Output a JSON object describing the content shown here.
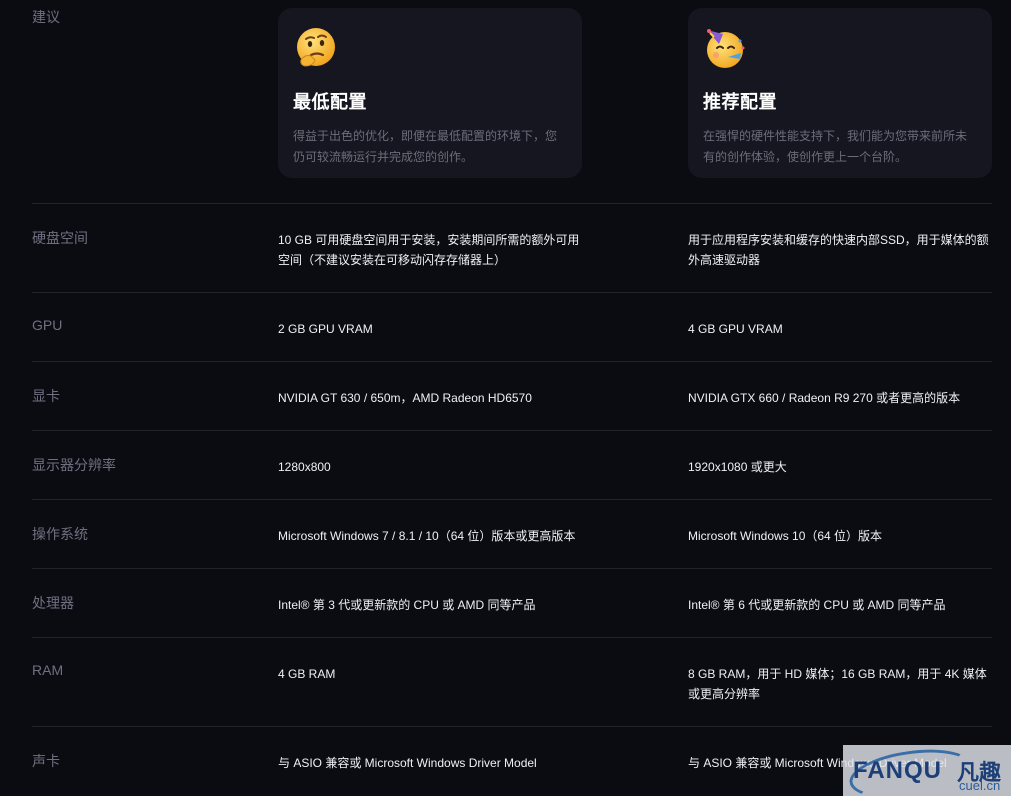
{
  "intro_label": "建议",
  "cards": {
    "min": {
      "icon": "thinking-face-emoji",
      "title": "最低配置",
      "description": "得益于出色的优化，即便在最低配置的环境下，您仍可较流畅运行并完成您的创作。"
    },
    "rec": {
      "icon": "partying-face-emoji",
      "title": "推荐配置",
      "description": "在强悍的硬件性能支持下，我们能为您带来前所未有的创作体验，使创作更上一个台阶。"
    }
  },
  "rows": [
    {
      "label": "硬盘空间",
      "min": "10 GB 可用硬盘空间用于安装，安装期间所需的额外可用空间（不建议安装在可移动闪存存储器上）",
      "rec": "用于应用程序安装和缓存的快速内部SSD，用于媒体的额外高速驱动器"
    },
    {
      "label": "GPU",
      "min": "2 GB GPU VRAM",
      "rec": "4 GB GPU VRAM"
    },
    {
      "label": "显卡",
      "min": "NVIDIA GT 630 / 650m，AMD Radeon HD6570",
      "rec": "NVIDIA GTX 660 / Radeon R9 270 或者更高的版本"
    },
    {
      "label": "显示器分辨率",
      "min": "1280x800",
      "rec": "1920x1080 或更大"
    },
    {
      "label": "操作系统",
      "min": "Microsoft Windows 7 / 8.1 / 10（64 位）版本或更高版本",
      "rec": "Microsoft Windows 10（64 位）版本"
    },
    {
      "label": "处理器",
      "min": "Intel® 第 3 代或更新款的 CPU 或 AMD 同等产品",
      "rec": "Intel® 第 6 代或更新款的 CPU 或 AMD 同等产品"
    },
    {
      "label": "RAM",
      "min": "4 GB RAM",
      "rec": "8 GB RAM，用于 HD 媒体；16 GB RAM，用于 4K 媒体或更高分辨率"
    },
    {
      "label": "声卡",
      "min": "与 ASIO 兼容或 Microsoft Windows Driver Model",
      "rec": "与 ASIO 兼容或 Microsoft Windows Driver Model"
    }
  ],
  "watermark": {
    "brand": "FANQU",
    "brand_cn": "凡趣",
    "domain": "cuel.cn"
  }
}
